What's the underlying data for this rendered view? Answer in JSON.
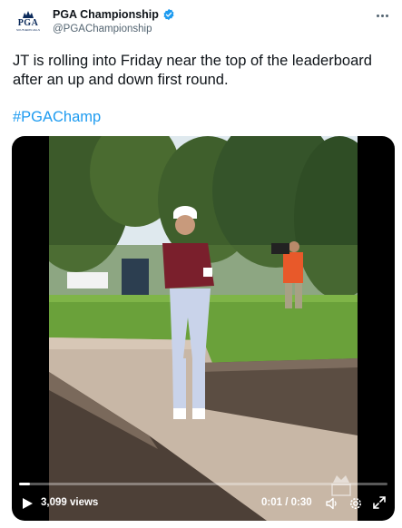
{
  "account": {
    "display_name": "PGA Championship",
    "handle": "@PGAChampionship",
    "avatar_text": "PGA",
    "avatar_subtext": "SOUTHERN HILLS",
    "verified": true
  },
  "tweet": {
    "text": "JT is rolling into Friday near the top of the leaderboard after an up and down first round.",
    "hashtag": "#PGAChamp"
  },
  "video": {
    "views": "3,099 views",
    "time": "0:01 / 0:30",
    "progress": 0.03
  },
  "icons": {
    "verified": "verified-badge-icon",
    "more": "more-options-icon",
    "play": "play-icon",
    "volume": "volume-icon",
    "settings": "settings-icon",
    "fullscreen": "fullscreen-icon"
  },
  "colors": {
    "hashtag": "#1d9bf0",
    "verified": "#1d9bf0",
    "text": "#0f1419",
    "secondary": "#536471",
    "video_bg": "#000000"
  }
}
